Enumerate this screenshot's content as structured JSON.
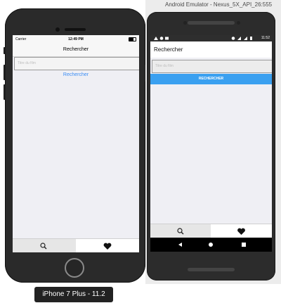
{
  "ios": {
    "status": {
      "carrier": "Carrier",
      "time": "12:49 PM"
    },
    "nav_title": "Rechercher",
    "search": {
      "placeholder": "Titre du film"
    },
    "search_link": "Rechercher",
    "tabs": [
      {
        "icon": "search-icon"
      },
      {
        "icon": "heart-icon"
      }
    ],
    "device_label": "iPhone 7 Plus - 11.2"
  },
  "android": {
    "window_title": "Android Emulator - Nexus_5X_API_26:555",
    "status": {
      "time": "11:52"
    },
    "appbar_title": "Rechercher",
    "search": {
      "placeholder": "Titre du film"
    },
    "search_button": "RECHERCHER",
    "tabs": [
      {
        "icon": "search-icon"
      },
      {
        "icon": "heart-icon"
      }
    ],
    "navbar": [
      {
        "icon": "back-icon"
      },
      {
        "icon": "home-icon"
      },
      {
        "icon": "recents-icon"
      }
    ]
  },
  "colors": {
    "ios_link": "#3b8df5",
    "android_button": "#3aa0f0"
  }
}
